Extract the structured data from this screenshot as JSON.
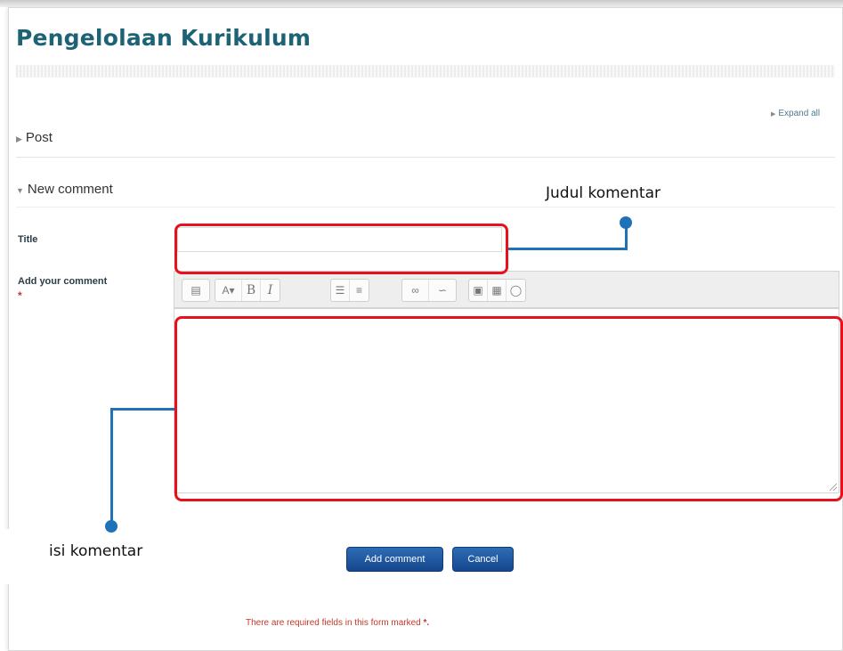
{
  "page": {
    "title": "Pengelolaan Kurikulum",
    "expand_all": "Expand all"
  },
  "sections": {
    "post": "Post",
    "new_comment": "New comment"
  },
  "form": {
    "title_label": "Title",
    "comment_label": "Add your comment",
    "required_star": "*",
    "title_value": "",
    "comment_value": ""
  },
  "toolbar": {
    "groups": [
      [
        "toolbar-toggle-icon"
      ],
      [
        "text-style-dropdown-icon",
        "bold-icon",
        "italic-icon"
      ],
      [
        "bulleted-list-icon",
        "numbered-list-icon"
      ],
      [
        "link-icon",
        "unlink-icon"
      ],
      [
        "insert-image-icon",
        "insert-media-icon",
        "manage-files-icon"
      ]
    ],
    "bold": "B",
    "italic": "I"
  },
  "buttons": {
    "add_comment": "Add comment",
    "cancel": "Cancel"
  },
  "footer": {
    "required_note": "There are required fields in this form marked",
    "required_mark": "*."
  },
  "annotations": {
    "title_callout": "Judul komentar",
    "editor_callout": "isi komentar"
  },
  "colors": {
    "page_title": "#1d6376",
    "highlight": "#e8101a",
    "callout": "#1f72b8",
    "button": "#1a56a0",
    "required": "#c0392b"
  }
}
